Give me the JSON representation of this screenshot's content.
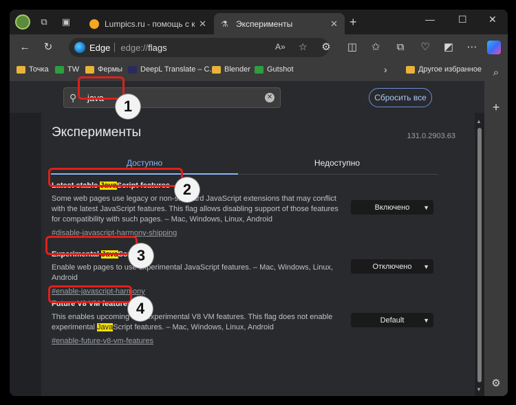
{
  "tabstrip": {
    "inactive_tab_title": "Lumpics.ru - помощь с компьютером",
    "active_tab_title": "Эксперименты",
    "new_tab_glyph": "+",
    "close_glyph": "✕",
    "window_controls": {
      "minimize": "—",
      "maximize": "☐",
      "close": "✕"
    }
  },
  "toolbar": {
    "brand": "Edge",
    "url_host": "edge://",
    "url_path": "flags",
    "icons": [
      "back-icon",
      "refresh-icon",
      "read-aloud-icon",
      "favorite-star-icon",
      "extensions-icon",
      "split-screen-icon",
      "favorites-icon",
      "collections-icon",
      "browser-essentials-icon",
      "screenshot-icon",
      "more-icon",
      "copilot-icon"
    ]
  },
  "bookmarks": {
    "items": [
      {
        "label": "Точка",
        "icon": "folder"
      },
      {
        "label": "TW",
        "icon": "green"
      },
      {
        "label": "Фермы",
        "icon": "folder"
      },
      {
        "label": "DeepL Translate – C...",
        "icon": "dark"
      },
      {
        "label": "Blender",
        "icon": "folder"
      },
      {
        "label": "Gutshot",
        "icon": "green"
      }
    ],
    "other_favorites": "Другое избранное",
    "more_glyph": "›"
  },
  "flags": {
    "search_value": "java",
    "reset_label": "Сбросить все",
    "heading": "Эксперименты",
    "version": "131.0.2903.63",
    "tab_available": "Доступно",
    "tab_unavailable": "Недоступно",
    "experiments": [
      {
        "name_pre": "Latest stable ",
        "name_mark": "Java",
        "name_post": "Script features",
        "desc": "Some web pages use legacy or non-standard JavaScript extensions that may conflict with the latest JavaScript features. This flag allows disabling support of those features for compatibility with such pages. – Mac, Windows, Linux, Android",
        "link": "#disable-javascript-harmony-shipping",
        "select": "Включено"
      },
      {
        "name_pre": "Experimental ",
        "name_mark": "Java",
        "name_post": "Script",
        "desc": "Enable web pages to use experimental JavaScript features. – Mac, Windows, Linux, Android",
        "link": "#enable-javascript-harmony",
        "select": "Отключено"
      },
      {
        "name_pre": "Future V8 VM features",
        "name_mark": "",
        "name_post": "",
        "desc_pre": "This enables upcoming and experimental V8 VM features. This flag does not enable experimental ",
        "desc_mark": "Java",
        "desc_post": "Script features. – Mac, Windows, Linux, Android",
        "link": "#enable-future-v8-vm-features",
        "select": "Default"
      }
    ]
  },
  "annotations": [
    "1",
    "2",
    "3",
    "4"
  ],
  "colors": {
    "highlight": "#f5e000",
    "annotation_red": "#e0201a",
    "accent_blue": "#8ab4f8"
  }
}
